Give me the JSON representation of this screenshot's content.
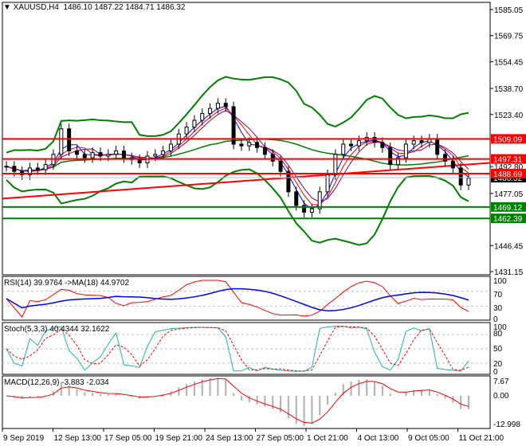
{
  "header": {
    "symbol": "XAUUSD,H4",
    "ohlc": "1486.10 1487.22 1484.71 1486.32"
  },
  "indicators": {
    "rsi": "RSI(14) 39.9764  ->MA(18) 44.9702",
    "stoch": "Stoch(5,3,3) 40.4344 32.1622",
    "macd": "MACD(12,26,9) -3.883 -2.034"
  },
  "chart_data": {
    "type": "candlestick",
    "title": "XAUUSD,H4",
    "ylim": [
      1431.15,
      1585.05
    ],
    "y_ticks": [
      "1585.05",
      "1569.75",
      "1554.45",
      "1538.70",
      "1523.40",
      "1492.80",
      "1477.05",
      "1446.45",
      "1431.15"
    ],
    "x_ticks": [
      "9 Sep 2019",
      "12 Sep 13:00",
      "17 Sep 05:00",
      "19 Sep 21:00",
      "24 Sep 13:00",
      "27 Sep 05:00",
      "1 Oct 21:00",
      "4 Oct 13:00",
      "9 Oct 05:00",
      "11 Oct 21:00"
    ],
    "closes": [
      1493,
      1490,
      1488,
      1492,
      1491,
      1494,
      1500,
      1515,
      1502,
      1500,
      1498,
      1501,
      1499,
      1500,
      1502,
      1498,
      1497,
      1495,
      1499,
      1500,
      1502,
      1506,
      1512,
      1516,
      1520,
      1524,
      1527,
      1530,
      1528,
      1506,
      1505,
      1507,
      1504,
      1500,
      1496,
      1490,
      1478,
      1470,
      1466,
      1468,
      1478,
      1488,
      1500,
      1506,
      1505,
      1508,
      1510,
      1507,
      1504,
      1494,
      1498,
      1506,
      1508,
      1507,
      1509,
      1500,
      1496,
      1492,
      1482,
      1486
    ],
    "current_price": {
      "value": 1486.32,
      "label": "1486.32"
    },
    "resistance_levels": [
      {
        "value": 1509.09,
        "label": "1509.09"
      },
      {
        "value": 1497.31,
        "label": "1497.31"
      },
      {
        "value": 1488.69,
        "label": "1488.69"
      }
    ],
    "support_levels": [
      {
        "value": 1469.12,
        "label": "1469.12"
      },
      {
        "value": 1462.39,
        "label": "1462.39"
      }
    ],
    "trendline": [
      1474,
      1495
    ],
    "rsi": {
      "levels": [
        "100",
        "70",
        "30",
        "0"
      ]
    },
    "stoch": {
      "levels": [
        "100",
        "80",
        "50",
        "20",
        "0"
      ]
    },
    "macd": {
      "levels": [
        "7.67",
        "0.00",
        "-12.998"
      ]
    },
    "colors": {
      "resistance": "#ff0000",
      "support": "#008000",
      "bands": "#008000"
    }
  }
}
